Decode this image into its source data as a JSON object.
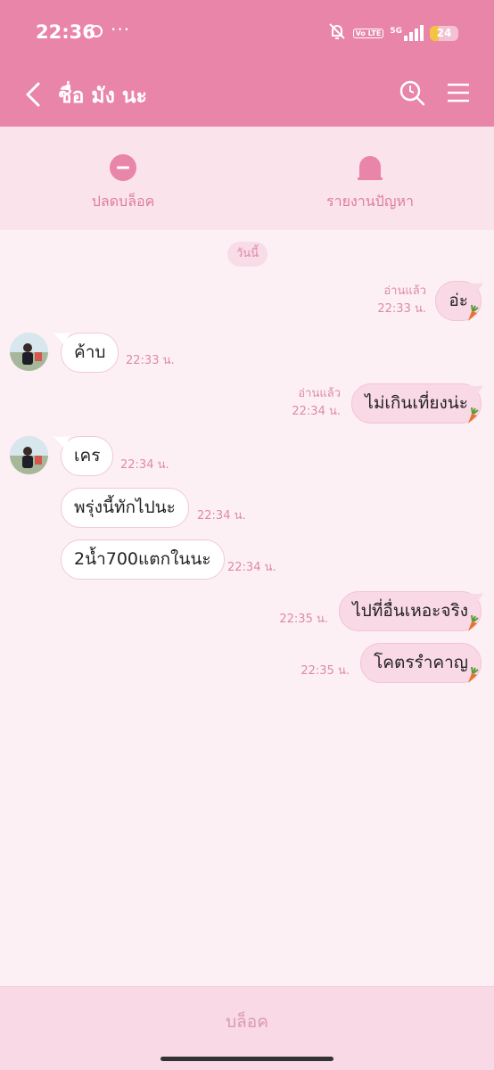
{
  "status_bar": {
    "time": "22:36",
    "volte_label": "Vo LTE",
    "network": "5G",
    "battery": "24",
    "icons": [
      "chat-bubble-icon",
      "more-dots-icon",
      "mute-icon",
      "volte-icon",
      "signal-icon",
      "battery-icon"
    ]
  },
  "header": {
    "title": "ชื่อ มัง นะ",
    "background": "#e985a8",
    "icons": [
      "back-arrow-icon",
      "search-icon",
      "menu-icon"
    ]
  },
  "actions": {
    "unblock_label": "ปลดบล็อค",
    "report_label": "รายงานปัญหา",
    "icons": [
      "minus-circle-icon",
      "report-bell-icon"
    ],
    "accent": "#e985a8"
  },
  "chat": {
    "date_label": "วันนี้",
    "messages": [
      {
        "dir": "out",
        "text": "อ่ะ",
        "read": "อ่านแล้ว",
        "time": "22:33 น."
      },
      {
        "dir": "in",
        "text": "ค้าบ",
        "time": "22:33 น."
      },
      {
        "dir": "out",
        "text": "ไม่เกินเที่ยงน่ะ",
        "read": "อ่านแล้ว",
        "time": "22:34 น."
      },
      {
        "dir": "in",
        "text": "เคร",
        "time": "22:34 น."
      },
      {
        "dir": "in",
        "text": "พรุ่งนี้ทักไปนะ",
        "time": "22:34 น."
      },
      {
        "dir": "in",
        "text": "2น้ำ700แตกในนะ",
        "time": "22:34 น."
      },
      {
        "dir": "out",
        "text": "ไปที่อื่นเหอะจริง",
        "time": "22:35 น."
      },
      {
        "dir": "out",
        "text": "โคตรรำคาญ",
        "time": "22:35 น."
      }
    ]
  },
  "bottom": {
    "block_label": "บล็อค"
  }
}
